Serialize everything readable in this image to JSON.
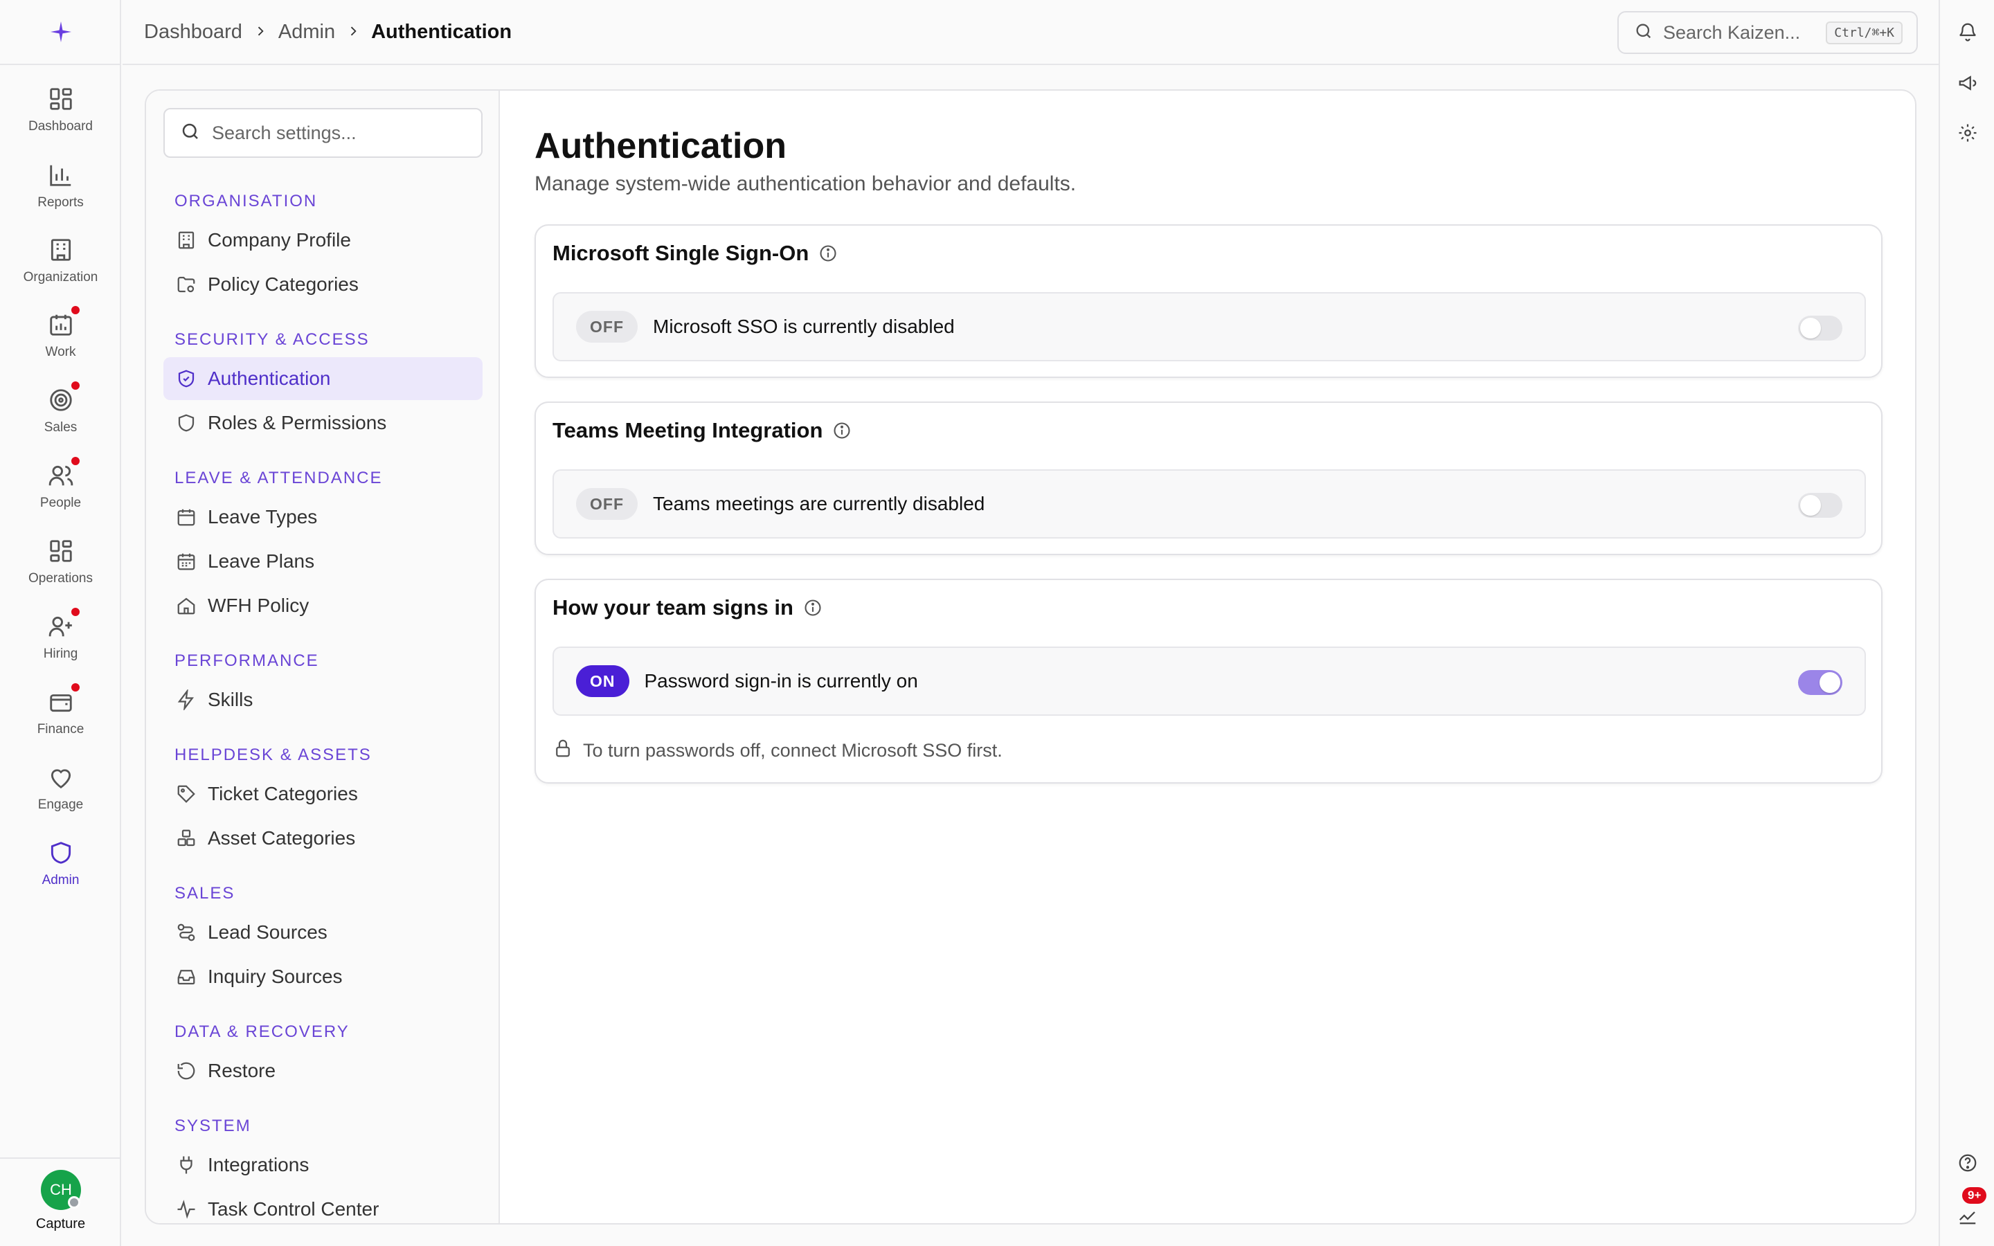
{
  "nav": {
    "items": [
      {
        "label": "Dashboard",
        "icon": "grid-icon",
        "badge": false
      },
      {
        "label": "Reports",
        "icon": "bar-chart-icon",
        "badge": false
      },
      {
        "label": "Organization",
        "icon": "building-icon",
        "badge": false
      },
      {
        "label": "Work",
        "icon": "calendar-chart-icon",
        "badge": true
      },
      {
        "label": "Sales",
        "icon": "target-icon",
        "badge": true
      },
      {
        "label": "People",
        "icon": "users-icon",
        "badge": true
      },
      {
        "label": "Operations",
        "icon": "grid-icon",
        "badge": false
      },
      {
        "label": "Hiring",
        "icon": "user-plus-icon",
        "badge": true
      },
      {
        "label": "Finance",
        "icon": "wallet-icon",
        "badge": true
      },
      {
        "label": "Engage",
        "icon": "heart-icon",
        "badge": false
      },
      {
        "label": "Admin",
        "icon": "shield-icon",
        "badge": false,
        "active": true
      }
    ],
    "user": {
      "initials": "CH",
      "label": "Capture"
    }
  },
  "breadcrumb": {
    "items": [
      "Dashboard",
      "Admin"
    ],
    "current": "Authentication"
  },
  "global_search": {
    "placeholder": "Search Kaizen...",
    "shortcut": "Ctrl/⌘+K"
  },
  "right_rail": {
    "notification_badge": "9+"
  },
  "settings": {
    "search_placeholder": "Search settings...",
    "sections": [
      {
        "title": "ORGANISATION",
        "items": [
          "Company Profile",
          "Policy Categories"
        ]
      },
      {
        "title": "SECURITY & ACCESS",
        "items": [
          "Authentication",
          "Roles & Permissions"
        ]
      },
      {
        "title": "LEAVE & ATTENDANCE",
        "items": [
          "Leave Types",
          "Leave Plans",
          "WFH Policy"
        ]
      },
      {
        "title": "PERFORMANCE",
        "items": [
          "Skills"
        ]
      },
      {
        "title": "HELPDESK & ASSETS",
        "items": [
          "Ticket Categories",
          "Asset Categories"
        ]
      },
      {
        "title": "SALES",
        "items": [
          "Lead Sources",
          "Inquiry Sources"
        ]
      },
      {
        "title": "DATA & RECOVERY",
        "items": [
          "Restore"
        ]
      },
      {
        "title": "SYSTEM",
        "items": [
          "Integrations",
          "Task Control Center"
        ]
      }
    ],
    "active_item": "Authentication"
  },
  "page": {
    "title": "Authentication",
    "subtitle": "Manage system-wide authentication behavior and defaults.",
    "cards": [
      {
        "title": "Microsoft Single Sign-On",
        "status": "OFF",
        "text": "Microsoft SSO is currently disabled",
        "enabled": false
      },
      {
        "title": "Teams Meeting Integration",
        "status": "OFF",
        "text": "Teams meetings are currently disabled",
        "enabled": false
      },
      {
        "title": "How your team signs in",
        "status": "ON",
        "text": "Password sign-in is currently on",
        "enabled": true,
        "note": "To turn passwords off, connect Microsoft SSO first."
      }
    ]
  },
  "colors": {
    "accent": "#4f2fc9",
    "badge": "#e00b1c",
    "avatar": "#16a34a"
  }
}
